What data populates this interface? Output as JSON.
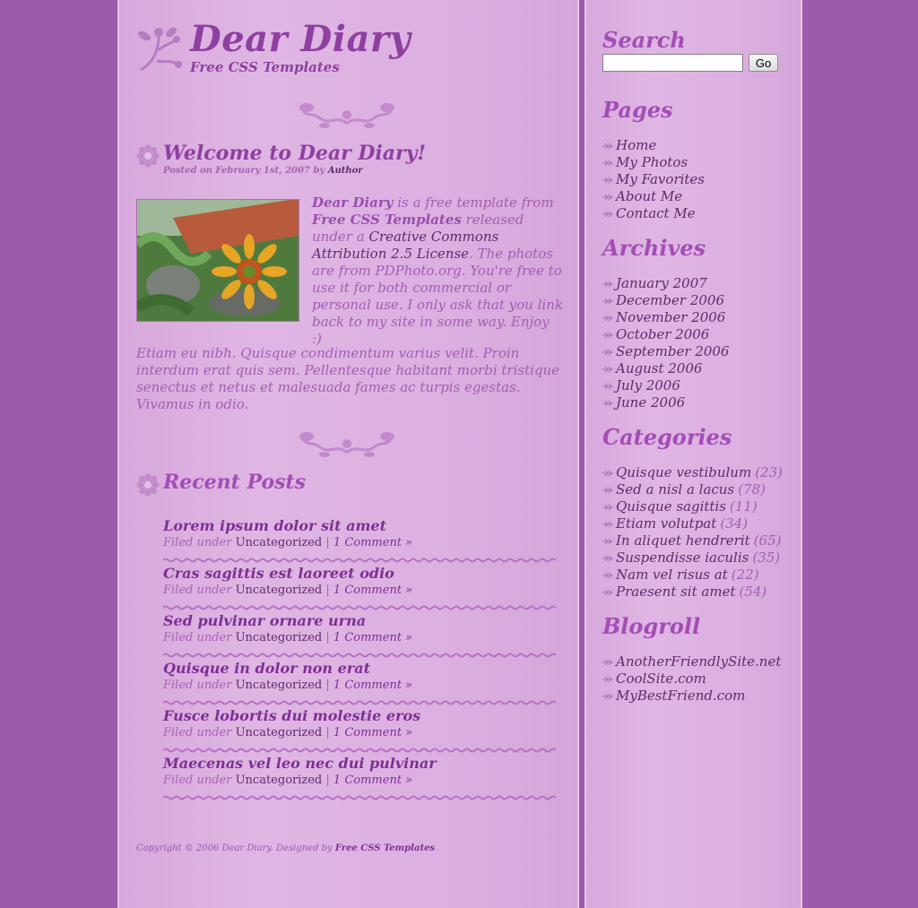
{
  "header": {
    "title": "Dear Diary",
    "subtitle": "Free CSS Templates"
  },
  "post": {
    "title": "Welcome to Dear Diary!",
    "meta_prefix": "Posted on February 1st, 2007 by ",
    "meta_author": "Author",
    "intro": {
      "brand": "Dear Diary",
      "t1": " is a free template from ",
      "site": "Free CSS Templates",
      "t2": " released under a ",
      "license": "Creative Commons Attribution 2.5 License",
      "t3": ". The photos are from PDPhoto.org. You're free to use it for both commercial or personal use. I only ask that you link back to my site in some way. Enjoy :)"
    },
    "paragraph": "Etiam eu nibh. Quisque condimentum varius velit. Proin interdum erat quis sem. Pellentesque habitant morbi tristique senectus et netus et malesuada fames ac turpis egestas. Vivamus in odio."
  },
  "recent": {
    "heading": "Recent Posts",
    "filed_label": "Filed under ",
    "separator": " | ",
    "items": [
      {
        "title": "Lorem ipsum dolor sit amet",
        "category": "Uncategorized",
        "comments": "1 Comment »"
      },
      {
        "title": "Cras sagittis est laoreet odio",
        "category": "Uncategorized",
        "comments": "1 Comment »"
      },
      {
        "title": "Sed pulvinar ornare urna",
        "category": "Uncategorized",
        "comments": "1 Comment »"
      },
      {
        "title": "Quisque in dolor non erat",
        "category": "Uncategorized",
        "comments": "1 Comment »"
      },
      {
        "title": "Fusce lobortis dui molestie eros",
        "category": "Uncategorized",
        "comments": "1 Comment »"
      },
      {
        "title": "Maecenas vel leo nec dui pulvinar",
        "category": "Uncategorized",
        "comments": "1 Comment »"
      }
    ]
  },
  "footer": {
    "copyright": "Copyright © 2006 Dear Diary. Designed by ",
    "designer": "Free CSS Templates"
  },
  "sidebar": {
    "search": {
      "heading": "Search",
      "value": "",
      "button": "Go"
    },
    "pages": {
      "heading": "Pages",
      "items": [
        "Home",
        "My Photos",
        "My Favorites",
        "About Me",
        "Contact Me"
      ]
    },
    "archives": {
      "heading": "Archives",
      "items": [
        "January 2007",
        "December 2006",
        "November 2006",
        "October 2006",
        "September 2006",
        "August 2006",
        "July 2006",
        "June 2006"
      ]
    },
    "categories": {
      "heading": "Categories",
      "items": [
        {
          "label": "Quisque vestibulum",
          "count": "(23)"
        },
        {
          "label": "Sed a nisl a lacus",
          "count": "(78)"
        },
        {
          "label": "Quisque sagittis",
          "count": "(11)"
        },
        {
          "label": "Etiam volutpat",
          "count": "(34)"
        },
        {
          "label": "In aliquet hendrerit",
          "count": "(65)"
        },
        {
          "label": "Suspendisse iaculis",
          "count": "(35)"
        },
        {
          "label": "Nam vel risus at",
          "count": "(22)"
        },
        {
          "label": "Praesent sit amet",
          "count": "(54)"
        }
      ]
    },
    "blogroll": {
      "heading": "Blogroll",
      "items": [
        "AnotherFriendlySite.net",
        "CoolSite.com",
        "MyBestFriend.com"
      ]
    }
  },
  "colors": {
    "page_bg": "#9c5ca9",
    "panel_bg": "#dcb0e1",
    "heading": "#8e3fa0",
    "link_dark": "#5e2a6b"
  }
}
